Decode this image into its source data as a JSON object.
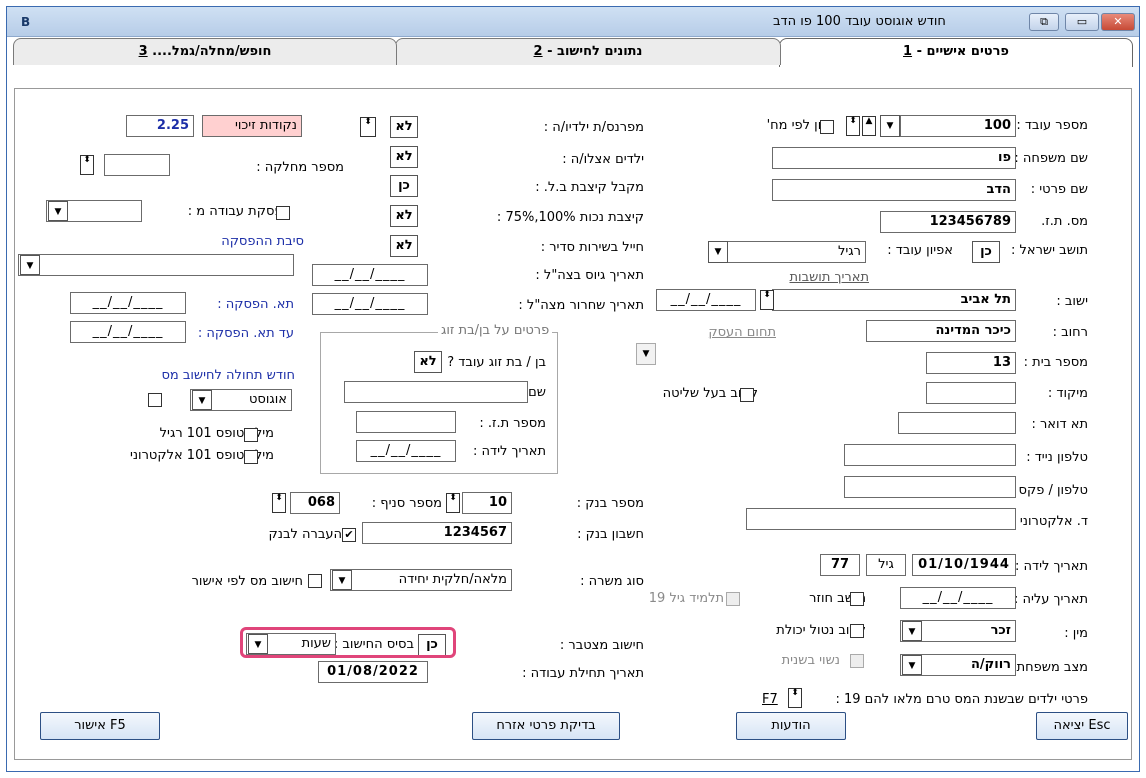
{
  "window": {
    "title": "חודש אוגוסט   עובד 100 פו הדב",
    "app_icon": "B",
    "minimize": "▭",
    "maximize": "⧉",
    "close": "✕"
  },
  "tabs": [
    {
      "key": "1",
      "label": "פרטים אישיים - "
    },
    {
      "key": "2",
      "label": "נתונים לחישוב - "
    },
    {
      "key": "3",
      "label": "חופש/מחלה/גמל.... "
    }
  ],
  "right": {
    "employee_no": {
      "label": "מספר עובד :",
      "value": "100"
    },
    "sort_by_id": "מיון לפי מח'",
    "last_name": {
      "label": "שם משפחה :",
      "value": "פו"
    },
    "first_name": {
      "label": "שם פרטי :",
      "value": "הדב"
    },
    "id_no": {
      "label": "מס. ת.ז.",
      "value": "123456789"
    },
    "israeli_resident": {
      "label": "תושב ישראל :",
      "value": "כן"
    },
    "employee_char": {
      "label": "אפיון עובד :",
      "value": "רגיל"
    },
    "residence_date_label": "תאריך תושבות",
    "residence_date": "__/__/____",
    "city": {
      "label": "ישוב :",
      "value": "תל אביב"
    },
    "street": {
      "label": "רחוב :",
      "value": "כיכר המדינה"
    },
    "business_field": "תחום העסק",
    "house_no": {
      "label": "מספר בית :",
      "value": "13"
    },
    "zip": {
      "label": "מיקוד :",
      "value": ""
    },
    "controlling_relative": "קרוב בעל שליטה",
    "po_box": {
      "label": "תא דואר :",
      "value": ""
    },
    "mobile": {
      "label": "טלפון נייד :",
      "value": ""
    },
    "phone_fax": {
      "label": "טלפון / פקס :",
      "value": ""
    },
    "email": {
      "label": "ד. אלקטרוני :",
      "value": ""
    },
    "birth_date": {
      "label": "תאריך לידה :",
      "value": "01/10/1944"
    },
    "age_label": "גיל",
    "age": "77",
    "aliyah_date": {
      "label": "תאריך עליה :",
      "value": "__/__/____"
    },
    "returning_resident": "תושב חוזר",
    "student_19": "תלמיד גיל 19",
    "gender": {
      "label": "מין :",
      "value": "זכר"
    },
    "disabled_relative": "קרוב נטול יכולת",
    "marital": {
      "label": "מצב משפחתי :",
      "value": "רווק/ה"
    },
    "married_in_year": "נשוי בשנית",
    "children_line": {
      "label": "פרטי ילדים שבשנת המס טרם מלאו להם 19 :",
      "key": "F7"
    }
  },
  "middle": {
    "single_parent": {
      "label": "מפרנס/ת ילדיו/ה :",
      "value": "לא"
    },
    "children_with_her": {
      "label": "ילדים אצלו/ה :",
      "value": "לא"
    },
    "allowance": {
      "label": "מקבל קיצבת  ב.ל. :",
      "value": "כן"
    },
    "disability": {
      "label": "קיצבת נכות 100%,75% :",
      "value": "לא"
    },
    "soldier": {
      "label": "חייל בשירות סדיר :",
      "value": "לא"
    },
    "draft_date": {
      "label": "תאריך גיוס בצה\"ל :",
      "value": "__/__/____"
    },
    "release_date": {
      "label": "תאריך שחרור מצה\"ל :",
      "value": "__/__/____"
    },
    "spouse_group": "פרטים על בן/בת זוג",
    "spouse_works": {
      "label": "בן / בת זוג עובד ? :",
      "value": "לא"
    },
    "spouse_name": {
      "label": "שם :",
      "value": ""
    },
    "spouse_id": {
      "label": "מספר ת.ז. :",
      "value": ""
    },
    "spouse_birth": {
      "label": "תאריך לידה :",
      "value": "__/__/____"
    },
    "bank_no": {
      "label": "מספר בנק :",
      "value": "10"
    },
    "branch_no": {
      "label": "מספר סניף :",
      "value": "068"
    },
    "account": {
      "label": "חשבון בנק :",
      "value": "1234567"
    },
    "bank_transfer": "העברה לבנק",
    "job_type": {
      "label": "סוג משרה :",
      "value": "מלאה/חלקית יחידה"
    },
    "tax_by_approval": "חישוב מס לפי אישור",
    "cumulative": {
      "label": "חישוב מצטבר :",
      "value": "כן"
    },
    "calc_basis": {
      "label": "בסיס החישוב :",
      "value": "שעות"
    },
    "start_date": {
      "label": "תאריך תחילת עבודה :",
      "value": "01/08/2022"
    }
  },
  "left": {
    "credit_points": {
      "label": "נקודות זיכוי",
      "value": "2.25"
    },
    "department": {
      "label": "מספר מחלקה :",
      "value": ""
    },
    "stop_work": "הפסקת עבודה מ :",
    "stop_reason": "סיבת ההפסקה",
    "stop_date": {
      "label": "תא. הפסקה :",
      "value": "__/__/____"
    },
    "until_stop_date": {
      "label": "עד תא. הפסקה :",
      "value": "__/__/____"
    },
    "tax_start_month": "חודש תחולה לחישוב מס",
    "tax_month_value": "אוגוסט",
    "form101_regular": "מילוי טופס 101 רגיל",
    "form101_electronic": "מילוי טופס 101 אלקטרוני"
  },
  "buttons": {
    "approve": "אישור F5",
    "check_civil": "בדיקת פרטי אזרח",
    "notices": "הודעות",
    "exit": "יציאה Esc"
  },
  "icons": {
    "spin": "⬍",
    "dropdown": "▼",
    "up": "▲",
    "check": "✔"
  }
}
